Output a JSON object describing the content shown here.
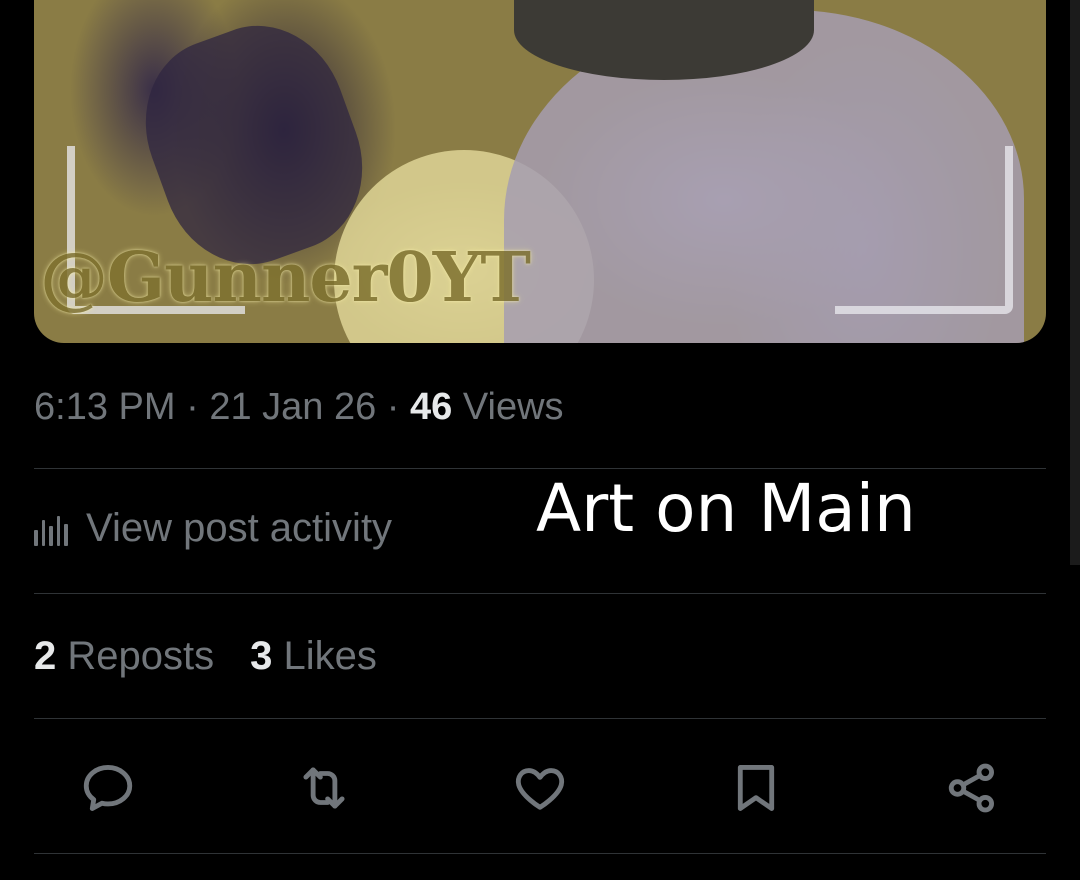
{
  "media": {
    "watermark": "@Gunner0YT"
  },
  "post_meta": {
    "time": "6:13 PM",
    "sep1": " · ",
    "date": "21 Jan 26",
    "sep2": " · ",
    "views_count": "46",
    "views_label": "Views"
  },
  "activity": {
    "label": "View post activity",
    "icon": "bar-chart-icon"
  },
  "overlay": {
    "text": "Art on Main"
  },
  "stats": {
    "reposts_count": "2",
    "reposts_label": "Reposts",
    "likes_count": "3",
    "likes_label": "Likes"
  },
  "actions": [
    {
      "name": "reply",
      "icon": "speech-bubble-icon"
    },
    {
      "name": "repost",
      "icon": "repost-arrows-icon"
    },
    {
      "name": "like",
      "icon": "heart-icon"
    },
    {
      "name": "bookmark",
      "icon": "bookmark-icon"
    },
    {
      "name": "share",
      "icon": "share-icon"
    }
  ],
  "colors": {
    "background": "#000000",
    "text_primary": "#e7e9ea",
    "text_secondary": "#71767b",
    "divider": "#2f3336"
  }
}
